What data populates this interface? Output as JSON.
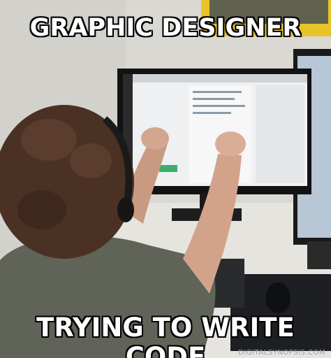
{
  "meme": {
    "top_text": "GRAPHIC DESIGNER",
    "bottom_text": "TRYING TO WRITE CODE",
    "watermark": "DIGITALSYNOPSIS.COM"
  }
}
